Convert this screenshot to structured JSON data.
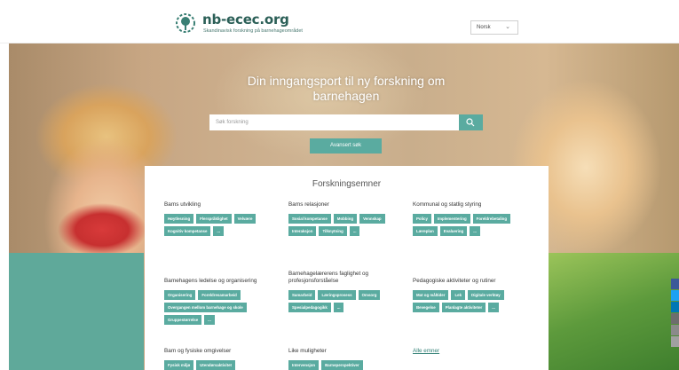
{
  "header": {
    "brand": "nb-ecec.org",
    "tagline": "Skandinavisk forskning på barnehageområdet",
    "language": "Norsk",
    "logo_icon": "tree-logo-icon"
  },
  "hero": {
    "title": "Din inngangsport til ny forskning om barnehagen",
    "search_placeholder": "Søk forskning",
    "search_icon": "search-icon",
    "advanced_search_label": "Avansert søk"
  },
  "topics": {
    "title": "Forskningsemner",
    "groups": [
      {
        "title": "Barns utvikling",
        "tags": [
          "Høytlesning",
          "Flerspråklighet",
          "Velvære",
          "Kognitiv kompetanse",
          "..."
        ]
      },
      {
        "title": "Barns relasjoner",
        "tags": [
          "Sosial kompetanse",
          "Mobbing",
          "Vennskap",
          "Interaksjon",
          "Tilknytning",
          "..."
        ]
      },
      {
        "title": "Kommunal og statlig styring",
        "tags": [
          "Policy",
          "Implementering",
          "Foreldrebetaling",
          "Læreplan",
          "Evaluering",
          "..."
        ]
      },
      {
        "title": "Barnehagens ledelse og organisering",
        "tags": [
          "Organisering",
          "Foreldresamarbeid",
          "Overgangen mellom barnehage og skole",
          "Gruppestørrelse",
          "..."
        ]
      },
      {
        "title": "Barnehagelærerens faglighet og profesjonsforståelse",
        "tags": [
          "Samarbeid",
          "Læringsprosess",
          "Omsorg",
          "Spesialpedagogikk",
          "..."
        ]
      },
      {
        "title": "Pedagogiske aktiviteter og rutiner",
        "tags": [
          "Mat og måltider",
          "Lek",
          "Digitale verktøy",
          "Bevegelse",
          "Planlagte aktiviteter",
          "..."
        ]
      },
      {
        "title": "Barn og fysiske omgivelser",
        "tags": [
          "Fysisk miljø",
          "Utendørsaktivitet"
        ]
      },
      {
        "title": "Like muligheter",
        "tags": [
          "Intervensjon",
          "Barneperspektiver"
        ]
      }
    ],
    "all_topics_link": "Alle emner"
  },
  "social": [
    "facebook-icon",
    "twitter-icon",
    "linkedin-icon",
    "print-icon",
    "email-icon",
    "share-icon"
  ],
  "colors": {
    "accent": "#5aaba0",
    "brand": "#2b5f57"
  }
}
